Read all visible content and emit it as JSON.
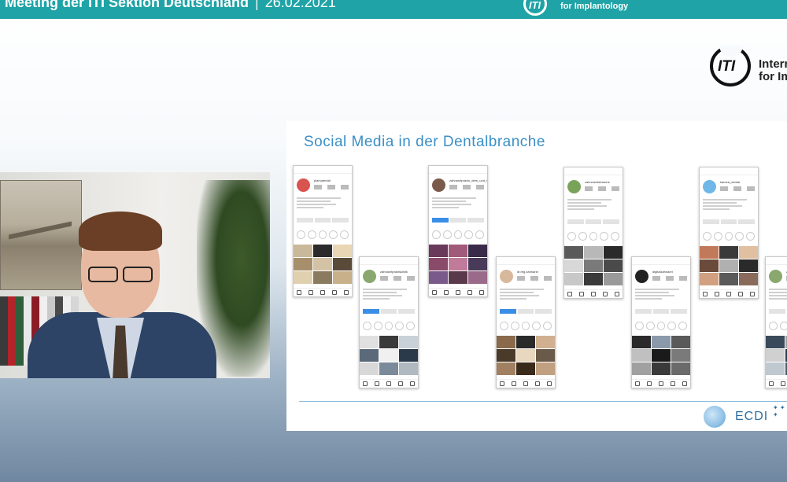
{
  "header": {
    "title": "Meeting der ITI Sektion Deutschland",
    "separator": "|",
    "date": "26.02.2021",
    "logo_mark": "ITI",
    "logo_text": "for Implantology",
    "bar_color": "#1fa3a6"
  },
  "corner_logo": {
    "mark": "ITI",
    "line1": "Intern",
    "line2": "for Imp"
  },
  "webcam": {
    "icon": "speaker-video-feed"
  },
  "slide": {
    "title": "Social Media in der Dentalbranche",
    "title_color": "#3a8fc7",
    "footer_logo": "ECDI",
    "footer_logo_color": "#2f6fa0",
    "phones": [
      {
        "name": "planudental",
        "avatar_color": "#d9534f",
        "primary_button": false
      },
      {
        "name": "zahnarztpraxis_dres_und_herzog",
        "avatar_color": "#7a5a4a",
        "primary_button": true
      },
      {
        "name": "zahnmedizinische",
        "avatar_color": "#7aa35a",
        "primary_button": false
      },
      {
        "name": "kamea_dental",
        "avatar_color": "#6fb7e6",
        "primary_button": false
      },
      {
        "name": "zahnarztpraxisklinik",
        "avatar_color": "#8aa86e",
        "primary_button": true
      },
      {
        "name": "dr.reg.zahnarzt",
        "avatar_color": "#d7b89a",
        "primary_button": true
      },
      {
        "name": "digitalzahnarzt",
        "avatar_color": "#222222",
        "primary_button": false
      },
      {
        "name": "zahnarzt",
        "avatar_color": "#8aa86e",
        "primary_button": false
      }
    ]
  }
}
